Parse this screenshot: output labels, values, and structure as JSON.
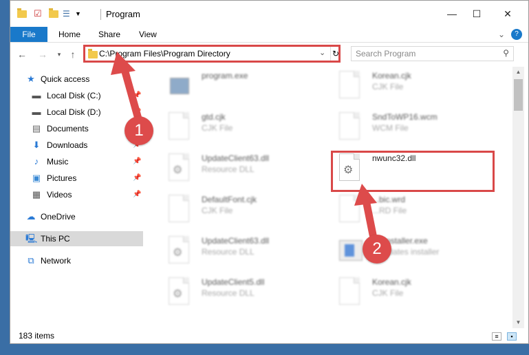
{
  "window": {
    "title": "Program",
    "controls": {
      "minimize": "—",
      "maximize": "☐",
      "close": "✕"
    }
  },
  "ribbon": {
    "tabs": [
      "File",
      "Home",
      "Share",
      "View"
    ]
  },
  "navigation": {
    "address": "C:\\Program Files\\Program Directory",
    "search_placeholder": "Search Program"
  },
  "sidebar": {
    "items": [
      {
        "label": "Quick access",
        "icon": "star-icon"
      },
      {
        "label": "Local Disk (C:)",
        "icon": "drive-icon",
        "pinned": true
      },
      {
        "label": "Local Disk (D:)",
        "icon": "drive-icon",
        "pinned": true
      },
      {
        "label": "Documents",
        "icon": "document-icon",
        "pinned": true
      },
      {
        "label": "Downloads",
        "icon": "download-icon",
        "pinned": true
      },
      {
        "label": "Music",
        "icon": "music-icon",
        "pinned": true
      },
      {
        "label": "Pictures",
        "icon": "picture-icon",
        "pinned": true
      },
      {
        "label": "Videos",
        "icon": "video-icon",
        "pinned": true
      },
      {
        "label": "OneDrive",
        "icon": "cloud-icon"
      },
      {
        "label": "This PC",
        "icon": "computer-icon",
        "selected": true
      },
      {
        "label": "Network",
        "icon": "network-icon"
      }
    ]
  },
  "files": [
    {
      "name": "program.exe",
      "type": ""
    },
    {
      "name": "Korean.cjk",
      "type": "CJK File"
    },
    {
      "name": "gtd.cjk",
      "type": "CJK File"
    },
    {
      "name": "SndToWP16.wcm",
      "type": "WCM File"
    },
    {
      "name": "UpdateClient63.dll",
      "type": "Resource DLL"
    },
    {
      "name": "nwunc32.dll",
      "type": ""
    },
    {
      "name": "DefaultFont.cjk",
      "type": "CJK File"
    },
    {
      "name": "...bic.wrd",
      "type": "...RD File"
    },
    {
      "name": "UpdateClient63.dll",
      "type": "Resource DLL"
    },
    {
      "name": "...eInstaller.exe",
      "type": "...updates installer"
    },
    {
      "name": "UpdateClient5.dll",
      "type": "Resource DLL"
    },
    {
      "name": "Korean.cjk",
      "type": "CJK File"
    }
  ],
  "status": {
    "item_count": "183 items"
  },
  "annotations": {
    "marker1": "1",
    "marker2": "2",
    "accent": "#d94848"
  }
}
